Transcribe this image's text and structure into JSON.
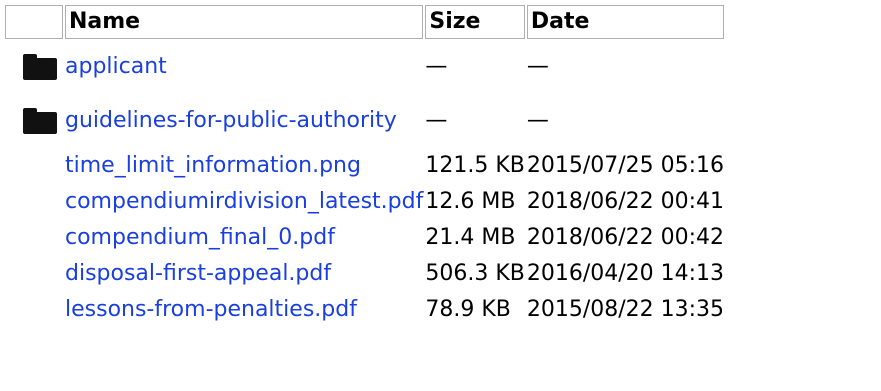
{
  "table": {
    "headers": {
      "name": "Name",
      "size": "Size",
      "date": "Date"
    },
    "folders": [
      {
        "name": "applicant",
        "size": "—",
        "date": "—",
        "icon": "folder-icon"
      },
      {
        "name": "guidelines-for-public-authority",
        "size": "—",
        "date": "—",
        "icon": "folder-icon"
      }
    ],
    "files": [
      {
        "name": "time_limit_information.png",
        "size": "121.5 KB",
        "date": "2015/07/25 05:16"
      },
      {
        "name": "compendiumirdivision_latest.pdf",
        "size": "12.6 MB",
        "date": "2018/06/22 00:41"
      },
      {
        "name": "compendium_final_0.pdf",
        "size": "21.4 MB",
        "date": "2018/06/22 00:42"
      },
      {
        "name": "disposal-first-appeal.pdf",
        "size": "506.3 KB",
        "date": "2016/04/20 14:13"
      },
      {
        "name": "lessons-from-penalties.pdf",
        "size": "78.9 KB",
        "date": "2015/08/22 13:35"
      }
    ]
  },
  "colors": {
    "link": "#1a3fe0",
    "header_border": "#b0b0b0"
  }
}
